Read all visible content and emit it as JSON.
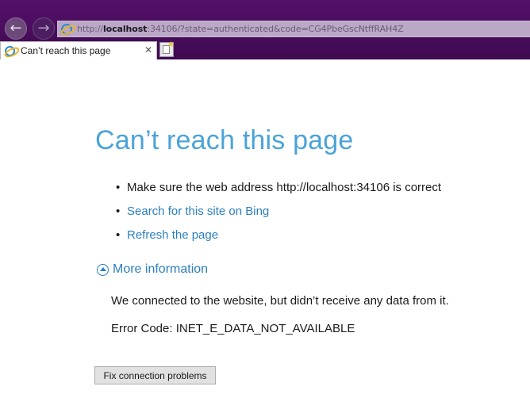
{
  "browser": {
    "back_icon": "←",
    "forward_icon": "→",
    "address": {
      "prefix": "http://",
      "host": "localhost",
      "rest": ":34106/?state=authenticated&code=CG4PbeGscNtffRAH4Z"
    },
    "tab": {
      "title": "Can’t reach this page",
      "close_icon": "✕"
    },
    "new_tab_icon": "new-tab-icon"
  },
  "page": {
    "heading": "Can’t reach this page",
    "suggestions": [
      {
        "text": "Make sure the web address http://localhost:34106 is correct",
        "link": false
      },
      {
        "text": "Search for this site on Bing",
        "link": true
      },
      {
        "text": "Refresh the page",
        "link": true
      }
    ],
    "more_info_label": "More information",
    "detail_message": "We connected to the website, but didn’t receive any data from it.",
    "error_code": "Error Code: INET_E_DATA_NOT_AVAILABLE",
    "fix_button_label": "Fix connection problems"
  },
  "colors": {
    "chrome": "#4a0d5e",
    "heading": "#4ba3d9",
    "link": "#2a7fc0"
  }
}
